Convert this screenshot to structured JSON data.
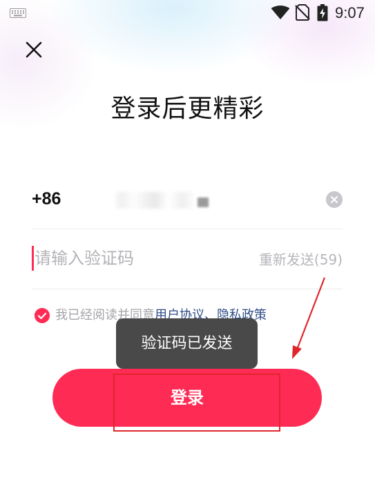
{
  "status_bar": {
    "time": "9:07",
    "icons": [
      "keyboard-icon",
      "wifi-icon",
      "no-sim-icon",
      "battery-charging-icon"
    ]
  },
  "header": {
    "close_icon": "close-icon",
    "title": "登录后更精彩"
  },
  "form": {
    "country_code": "+86",
    "phone_value": "",
    "clear_icon": "clear-icon",
    "code_placeholder": "请输入验证码",
    "resend_label": "重新发送(59)"
  },
  "agreement": {
    "checked": true,
    "prefix": "我已经阅读并同意",
    "user_agreement": "用户协议",
    "separator": "、",
    "privacy_policy": "隐私政策"
  },
  "toast": {
    "message": "验证码已发送"
  },
  "login_button": {
    "label": "登录"
  },
  "colors": {
    "accent": "#fe2c55",
    "link": "#2e4a86",
    "annotation": "#e0262b",
    "toast_bg": "#424242"
  }
}
